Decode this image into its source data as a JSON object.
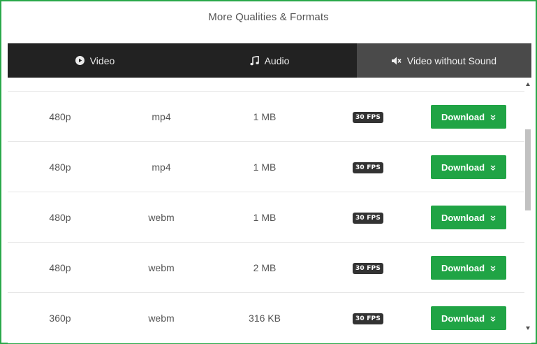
{
  "header": {
    "title": "More Qualities & Formats"
  },
  "tabs": [
    {
      "label": "Video",
      "icon": "play-circle-icon",
      "active": false
    },
    {
      "label": "Audio",
      "icon": "music-note-icon",
      "active": false
    },
    {
      "label": "Video without Sound",
      "icon": "mute-icon",
      "active": true
    }
  ],
  "rows": [
    {
      "quality": "480p",
      "format": "mp4",
      "size": "1 MB",
      "fps": "30 FPS",
      "button": "Download"
    },
    {
      "quality": "480p",
      "format": "mp4",
      "size": "1 MB",
      "fps": "30 FPS",
      "button": "Download"
    },
    {
      "quality": "480p",
      "format": "webm",
      "size": "1 MB",
      "fps": "30 FPS",
      "button": "Download"
    },
    {
      "quality": "480p",
      "format": "webm",
      "size": "2 MB",
      "fps": "30 FPS",
      "button": "Download"
    },
    {
      "quality": "360p",
      "format": "webm",
      "size": "316 KB",
      "fps": "30 FPS",
      "button": "Download"
    }
  ],
  "colors": {
    "accent": "#20a445",
    "tabbar": "#222222",
    "active_tab": "#4a4a4a",
    "border": "#2aa84a"
  }
}
